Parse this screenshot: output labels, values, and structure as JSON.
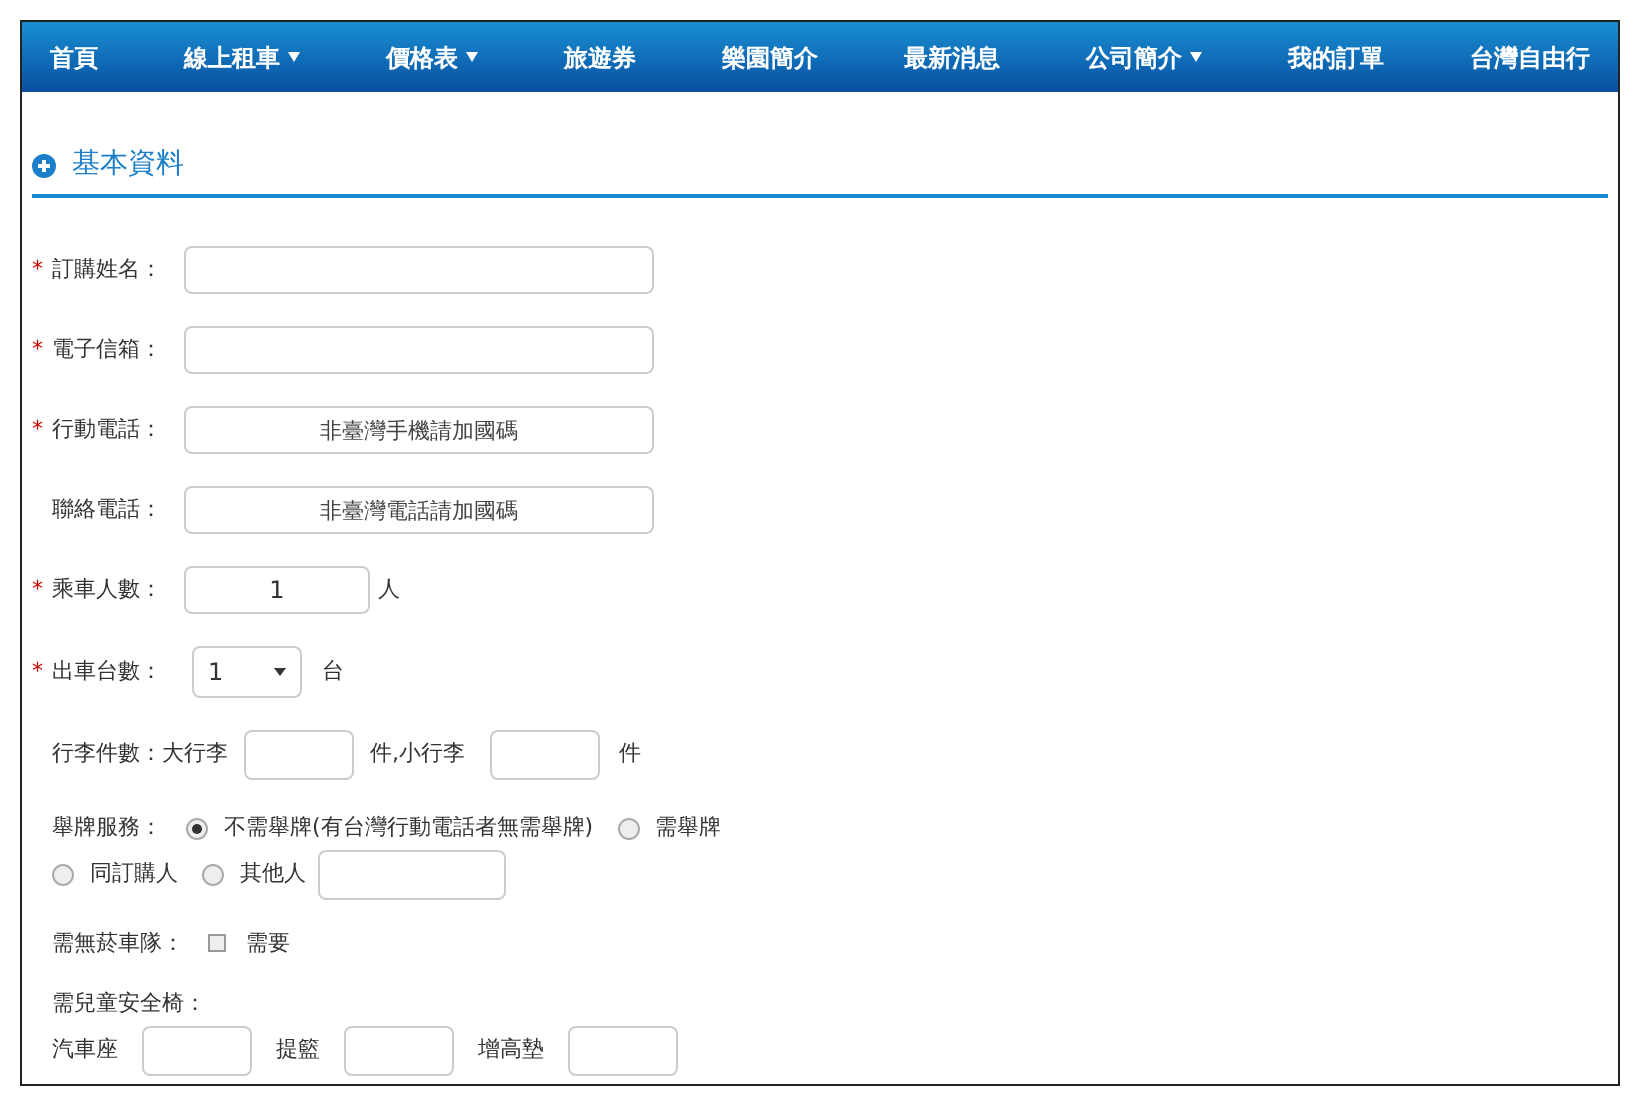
{
  "nav": [
    {
      "label": "首頁",
      "dropdown": false
    },
    {
      "label": "線上租車",
      "dropdown": true
    },
    {
      "label": "價格表",
      "dropdown": true
    },
    {
      "label": "旅遊券",
      "dropdown": false
    },
    {
      "label": "樂園簡介",
      "dropdown": false
    },
    {
      "label": "最新消息",
      "dropdown": false
    },
    {
      "label": "公司簡介",
      "dropdown": true
    },
    {
      "label": "我的訂單",
      "dropdown": false
    },
    {
      "label": "台灣自由行",
      "dropdown": false
    }
  ],
  "section_title": "基本資料",
  "fields": [
    {
      "label": "訂購姓名：",
      "required_mark": "*"
    },
    {
      "label": "電子信箱：",
      "required_mark": "*"
    },
    {
      "label": "行動電話：",
      "required_mark": "*",
      "placeholder": "非臺灣手機請加國碼"
    },
    {
      "label": "聯絡電話：",
      "placeholder": "非臺灣電話請加國碼"
    }
  ],
  "passengers": {
    "label": "乘車人數：",
    "required_mark": "*",
    "value": "1",
    "unit": "人"
  },
  "cars": {
    "label": "出車台數：",
    "required_mark": "*",
    "value": "1",
    "unit": "台"
  },
  "luggage": {
    "label": "行李件數：大行李",
    "unit_large": "件,小行李",
    "unit_small": "件"
  },
  "sign_service": {
    "label": "舉牌服務：",
    "options": [
      {
        "label": "不需舉牌(有台灣行動電話者無需舉牌)",
        "selected": true
      },
      {
        "label": "需舉牌",
        "selected": false
      },
      {
        "label": "同訂購人",
        "selected": false
      },
      {
        "label": "其他人",
        "selected": false
      }
    ]
  },
  "smoke_free": {
    "label": "需無菸車隊：",
    "option": "需要",
    "checked": false
  },
  "child_seats": {
    "label": "需兒童安全椅：",
    "items": [
      "汽車座",
      "提籃",
      "增高墊"
    ]
  }
}
